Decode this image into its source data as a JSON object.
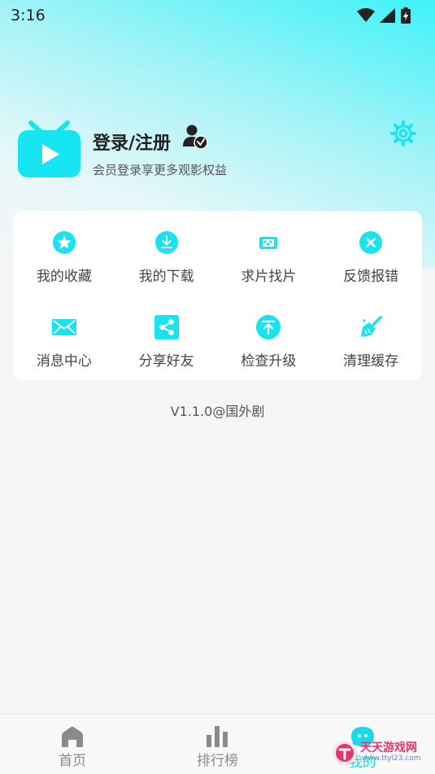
{
  "status_bar": {
    "time": "3:16"
  },
  "profile": {
    "title": "登录/注册",
    "subtitle": "会员登录享更多观影权益"
  },
  "menu": {
    "items": [
      {
        "label": "我的收藏",
        "icon": "star-icon"
      },
      {
        "label": "我的下载",
        "icon": "download-icon"
      },
      {
        "label": "求片找片",
        "icon": "film-icon"
      },
      {
        "label": "反馈报错",
        "icon": "close-circle-icon"
      },
      {
        "label": "消息中心",
        "icon": "mail-icon"
      },
      {
        "label": "分享好友",
        "icon": "share-icon"
      },
      {
        "label": "检查升级",
        "icon": "upgrade-icon"
      },
      {
        "label": "清理缓存",
        "icon": "broom-icon"
      }
    ]
  },
  "version": "V1.1.0@国外剧",
  "tabbar": {
    "tabs": [
      {
        "label": "首页",
        "icon": "home-icon"
      },
      {
        "label": "排行榜",
        "icon": "bar-chart-icon"
      },
      {
        "label": "我的",
        "icon": "chat-face-icon",
        "active": true
      }
    ]
  },
  "watermark": {
    "line1": "天天游戏网",
    "line2": "www.ttyl23.com"
  },
  "colors": {
    "accent": "#1ad9e6",
    "icon": "#18e3ef",
    "text": "#444444"
  }
}
